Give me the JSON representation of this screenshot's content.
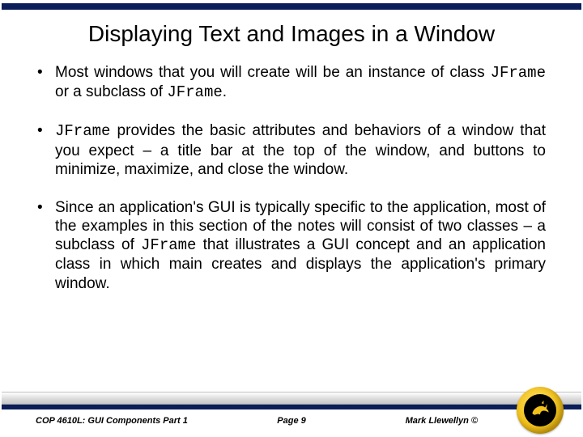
{
  "title": "Displaying Text and Images in a Window",
  "bullets": {
    "b1": {
      "t1": "Most windows that you will create will be an instance of class ",
      "c1": "JFrame",
      "t2": " or a subclass of ",
      "c2": "JFrame",
      "t3": "."
    },
    "b2": {
      "c1": "JFrame",
      "t1": " provides the basic attributes and behaviors of a window that you expect – a title bar at the top of the window, and buttons to minimize, maximize, and close the window."
    },
    "b3": {
      "t1": "Since an application's GUI is typically specific to the application, most of the examples in this section of the notes will consist of two classes – a subclass of ",
      "c1": "JFrame",
      "t2": " that illustrates a GUI concept and an application class in which main creates and displays the application's primary window."
    }
  },
  "footer": {
    "course": "COP 4610L: GUI Components Part 1",
    "page": "Page 9",
    "author": "Mark Llewellyn ©"
  }
}
